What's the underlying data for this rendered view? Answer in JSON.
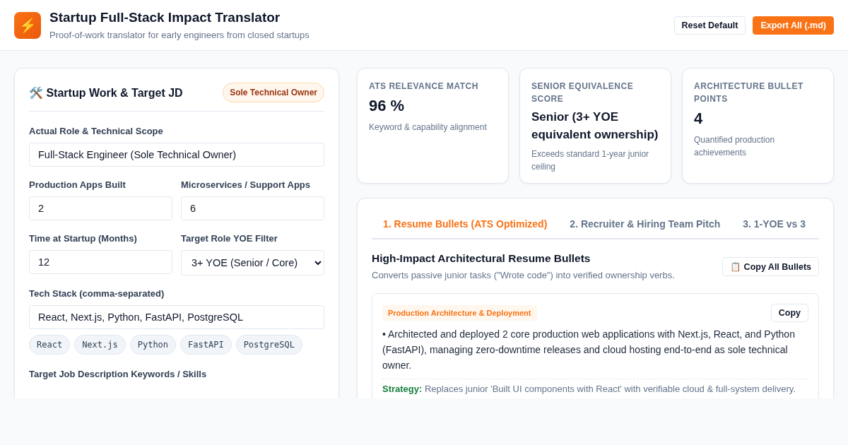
{
  "header": {
    "logo": "⚡",
    "title": "Startup Full-Stack Impact Translator",
    "subtitle": "Proof-of-work translator for early engineers from closed startups",
    "buttons": [
      {
        "label": "Reset Default",
        "kind": "secondary"
      },
      {
        "label": "Export All (.md)",
        "kind": "primary"
      }
    ]
  },
  "form": {
    "title": "🛠️ Startup Work & Target JD",
    "badge": "Sole Technical Owner",
    "rows": [
      [
        {
          "label": "Actual Role & Technical Scope",
          "kind": "text",
          "value": "Full-Stack Engineer (Sole Technical Owner)"
        }
      ],
      [
        {
          "label": "Production Apps Built",
          "kind": "text",
          "value": "2"
        },
        {
          "label": "Microservices / Support Apps",
          "kind": "text",
          "value": "6"
        }
      ],
      [
        {
          "label": "Time at Startup (Months)",
          "kind": "text",
          "value": "12"
        },
        {
          "label": "Target Role YOE Filter",
          "kind": "select",
          "value": "3+ YOE (Senior / Core)"
        }
      ],
      [
        {
          "label": "Tech Stack (comma-separated)",
          "kind": "text",
          "value": "React, Next.js, Python, FastAPI, PostgreSQL"
        }
      ]
    ],
    "tags": [
      "React",
      "Next.js",
      "Python",
      "FastAPI",
      "PostgreSQL"
    ],
    "next_label": "Target Job Description Keywords / Skills"
  },
  "stats": [
    {
      "label": "ATS RELEVANCE MATCH",
      "value": "96 %",
      "note": "Keyword & capability alignment"
    },
    {
      "label": "SENIOR EQUIVALENCE SCORE",
      "value": "Senior (3+ YOE equivalent ownership)",
      "note": "Exceeds standard 1-year junior ceiling"
    },
    {
      "label": "ARCHITECTURE BULLET POINTS",
      "value": "4",
      "note": "Quantified production achievements"
    }
  ],
  "tabs": [
    {
      "label": "1. Resume Bullets (ATS Optimized)",
      "selected": true
    },
    {
      "label": "2. Recruiter & Hiring Team Pitch",
      "selected": false
    },
    {
      "label": "3. 1-YOE vs 3",
      "selected": false
    }
  ],
  "section": {
    "title": "High-Impact Architectural Resume Bullets",
    "subtitle": "Converts passive junior tasks (\"Wrote code\") into verified ownership verbs.",
    "copy_all": "📋 Copy All Bullets"
  },
  "bullets": [
    {
      "category": "Production Architecture & Deployment",
      "copy": "Copy",
      "text": "• Architected and deployed 2 core production web applications with Next.js, React, and Python (FastAPI), managing zero-downtime releases and cloud hosting end-to-end as sole technical owner.",
      "strategy": "**Strategy:** Replaces junior 'Built UI components with React' with verifiable cloud & full-system delivery."
    }
  ]
}
